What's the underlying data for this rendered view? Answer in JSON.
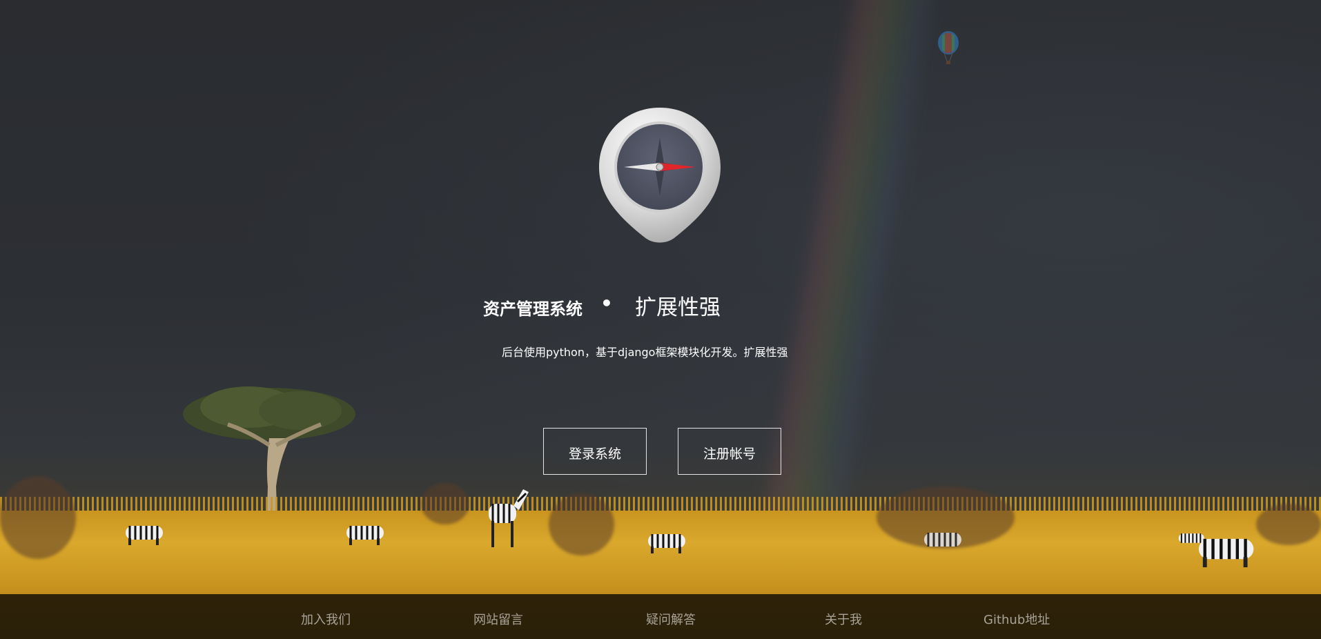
{
  "hero": {
    "title_main": "资产管理系统",
    "separator": "•",
    "title_sub": "扩展性强",
    "description": "后台使用python，基于django框架模块化开发。扩展性强"
  },
  "buttons": {
    "login_label": "登录系统",
    "register_label": "注册帐号"
  },
  "footer": {
    "links": [
      "加入我们",
      "网站留言",
      "疑问解答",
      "关于我",
      "Github地址"
    ]
  },
  "logo": {
    "icon": "compass-icon"
  },
  "colors": {
    "sky": "#2c2f34",
    "grass": "#d9a82c",
    "footer_bg": "#221a08",
    "footer_text": "#a9a398",
    "text": "#ffffff",
    "compass_needle": "#e0262b"
  }
}
